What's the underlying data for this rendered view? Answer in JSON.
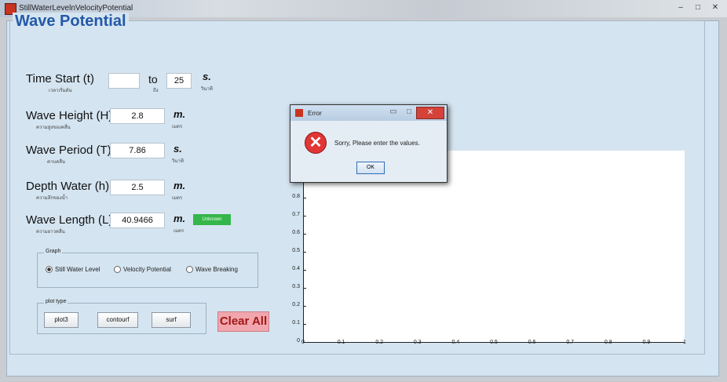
{
  "window": {
    "title": "StillWaterLevelnVelocityPotential"
  },
  "panel": {
    "title": "Wave Potential"
  },
  "fields": {
    "time_start": {
      "label": "Time Start (t)",
      "thai": "เวลาเริ่มต้น",
      "value": "",
      "to_label": "to",
      "to_thai": "ถึง",
      "to_value": "25",
      "unit": "s.",
      "unit_thai": "วินาที"
    },
    "wave_height": {
      "label": "Wave Height (H)",
      "thai": "ความสูงของคลื่น",
      "value": "2.8",
      "unit": "m.",
      "unit_thai": "เมตร"
    },
    "wave_period": {
      "label": "Wave Period (T)",
      "thai": "คาบคลื่น",
      "value": "7.86",
      "unit": "s.",
      "unit_thai": "วินาที"
    },
    "depth_water": {
      "label": "Depth Water (h)",
      "thai": "ความลึกของน้ำ",
      "value": "2.5",
      "unit": "m.",
      "unit_thai": "เมตร"
    },
    "wave_length": {
      "label": "Wave Length (L)",
      "thai": "ความยาวคลื่น",
      "value": "40.9466",
      "unit": "m.",
      "unit_thai": "เมตร",
      "badge": "Unknown"
    }
  },
  "graph_group": {
    "title": "Graph",
    "options": [
      {
        "label": "Still Water Level",
        "selected": true
      },
      {
        "label": "Velocity Potential",
        "selected": false
      },
      {
        "label": "Wave Breaking",
        "selected": false
      }
    ]
  },
  "plot_type_group": {
    "title": "plot type",
    "buttons": [
      "plot3",
      "contourf",
      "surf"
    ]
  },
  "clear_all": "Clear All",
  "axes": {
    "y_ticks": [
      "0",
      "0.1",
      "0.2",
      "0.3",
      "0.4",
      "0.5",
      "0.6",
      "0.7",
      "0.8"
    ],
    "x_ticks": [
      "0",
      "0.1",
      "0.2",
      "0.3",
      "0.4",
      "0.5",
      "0.6",
      "0.7",
      "0.8",
      "0.9",
      "1"
    ]
  },
  "dialog": {
    "title": "Error",
    "message": "Sorry, Please enter the values.",
    "ok": "OK"
  },
  "colors": {
    "panel_bg": "#d4e4f0",
    "title_blue": "#2359a8",
    "clear_bg": "#f1a6ad",
    "badge_green": "#35b64a",
    "error_red": "#e23535"
  }
}
